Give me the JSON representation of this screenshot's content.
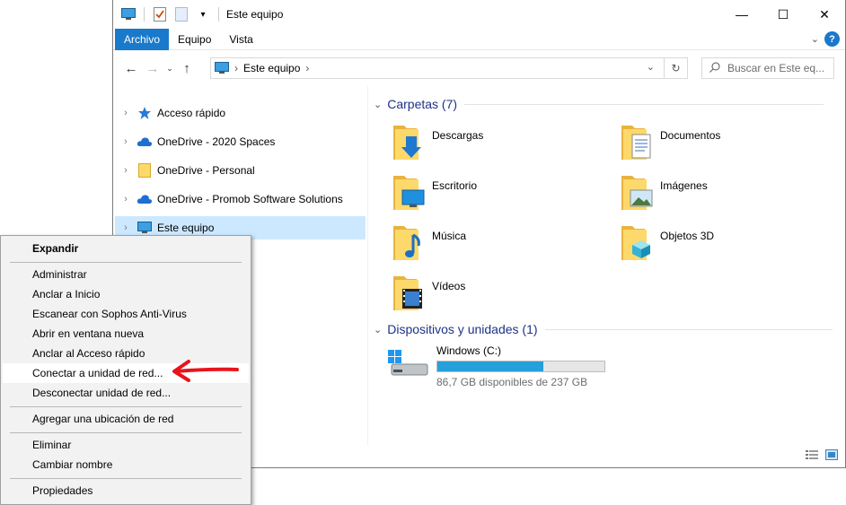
{
  "window": {
    "title": "Este equipo",
    "controls": {
      "minimize": "—",
      "maximize": "☐",
      "close": "✕"
    }
  },
  "ribbon": {
    "tabs": [
      {
        "label": "Archivo",
        "active": true
      },
      {
        "label": "Equipo",
        "active": false
      },
      {
        "label": "Vista",
        "active": false
      }
    ],
    "help": "?"
  },
  "address": {
    "path": "Este equipo",
    "search_placeholder": "Buscar en Este eq..."
  },
  "nav_pane": {
    "items": [
      {
        "label": "Acceso rápido",
        "icon": "star-icon"
      },
      {
        "label": "OneDrive - 2020 Spaces",
        "icon": "cloud-icon"
      },
      {
        "label": "OneDrive - Personal",
        "icon": "folder-icon"
      },
      {
        "label": "OneDrive - Promob Software Solutions",
        "icon": "cloud-icon"
      },
      {
        "label": "Este equipo",
        "icon": "computer-icon",
        "selected": true
      }
    ]
  },
  "content": {
    "folders_header": "Carpetas (7)",
    "folders": [
      {
        "label": "Descargas",
        "icon": "downloads-folder-icon"
      },
      {
        "label": "Documentos",
        "icon": "documents-folder-icon"
      },
      {
        "label": "Escritorio",
        "icon": "desktop-folder-icon"
      },
      {
        "label": "Imágenes",
        "icon": "pictures-folder-icon"
      },
      {
        "label": "Música",
        "icon": "music-folder-icon"
      },
      {
        "label": "Objetos 3D",
        "icon": "3d-objects-folder-icon"
      },
      {
        "label": "Vídeos",
        "icon": "videos-folder-icon"
      }
    ],
    "devices_header": "Dispositivos y unidades (1)",
    "drive": {
      "label": "Windows (C:)",
      "free_text": "86,7 GB disponibles de 237 GB",
      "used_fraction": 0.634
    }
  },
  "context_menu": {
    "items": [
      {
        "label": "Expandir",
        "bold": true
      },
      {
        "sep": true
      },
      {
        "label": "Administrar"
      },
      {
        "label": "Anclar a Inicio"
      },
      {
        "label": "Escanear con Sophos Anti-Virus"
      },
      {
        "label": "Abrir en ventana nueva"
      },
      {
        "label": "Anclar al Acceso rápido"
      },
      {
        "label": "Conectar a unidad de red...",
        "highlight": true
      },
      {
        "label": "Desconectar unidad de red..."
      },
      {
        "sep": true
      },
      {
        "label": "Agregar una ubicación de red"
      },
      {
        "sep": true
      },
      {
        "label": "Eliminar"
      },
      {
        "label": "Cambiar nombre"
      },
      {
        "sep": true
      },
      {
        "label": "Propiedades"
      }
    ]
  },
  "colors": {
    "accent": "#1979ca",
    "selection": "#cce8ff",
    "group_header": "#1e3287",
    "drive_bar": "#26a0da",
    "annotation_arrow": "#e8141c",
    "folder_yellow": "#f4c542"
  }
}
